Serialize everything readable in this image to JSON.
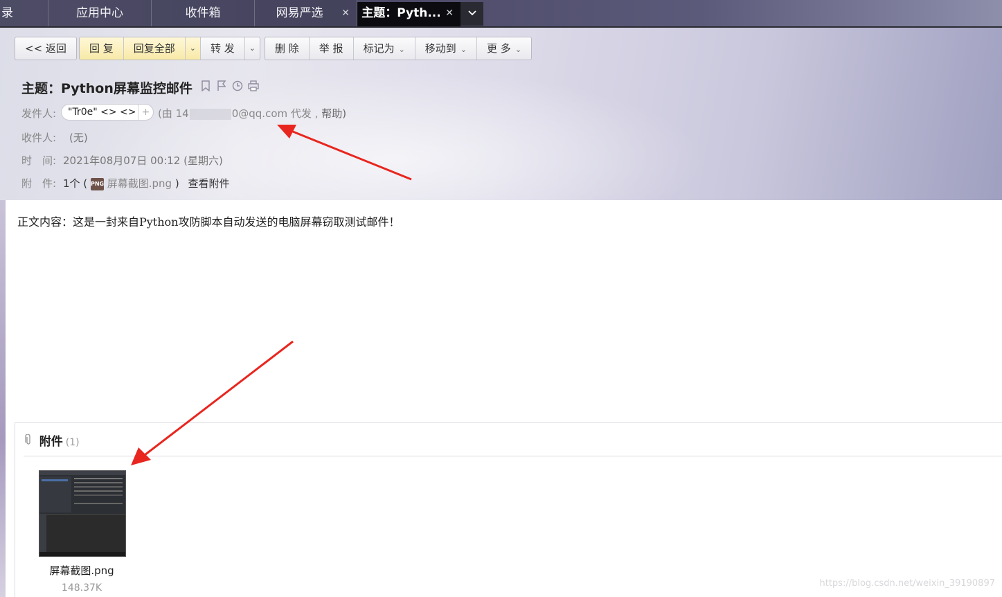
{
  "tabs": [
    {
      "label": "录"
    },
    {
      "label": "应用中心"
    },
    {
      "label": "收件箱"
    },
    {
      "label": "网易严选",
      "close": "✕"
    },
    {
      "label": "主题：Pyth...",
      "close": "✕"
    }
  ],
  "tab_overflow_icon": "chevron-down-icon",
  "toolbar": {
    "back": "<< 返回",
    "reply": "回 复",
    "reply_all": "回复全部",
    "forward": "转 发",
    "delete": "删 除",
    "report": "举 报",
    "mark_as": "标记为",
    "move_to": "移动到",
    "more": "更 多"
  },
  "mail": {
    "subject": "主题：Python屏幕监控邮件",
    "from_label": "发件人:",
    "from_name": "\"Tr0e\" <> <>",
    "via_prefix": "(由 14",
    "via_suffix": "0@qq.com 代发 ,",
    "via_help": "帮助)",
    "to_label": "收件人:",
    "to_value": "(无)",
    "time_label": "时　间:",
    "time_value": "2021年08月07日 00:12 (星期六)",
    "att_label": "附　件:",
    "att_count": "1个 (",
    "att_file": "屏幕截图.png",
    "att_close": ")",
    "att_view": "查看附件",
    "png_badge": "PNG"
  },
  "body": {
    "text": "正文内容：这是一封来自Python攻防脚本自动发送的电脑屏幕窃取测试邮件！"
  },
  "attachments": {
    "title": "附件",
    "count": "(1)",
    "items": [
      {
        "name": "屏幕截图.png",
        "size": "148.37K"
      }
    ]
  },
  "watermark": "https://blog.csdn.net/weixin_39190897",
  "colors": {
    "annotation_arrow": "#e8261f",
    "active_tab": "#0b0b10"
  }
}
